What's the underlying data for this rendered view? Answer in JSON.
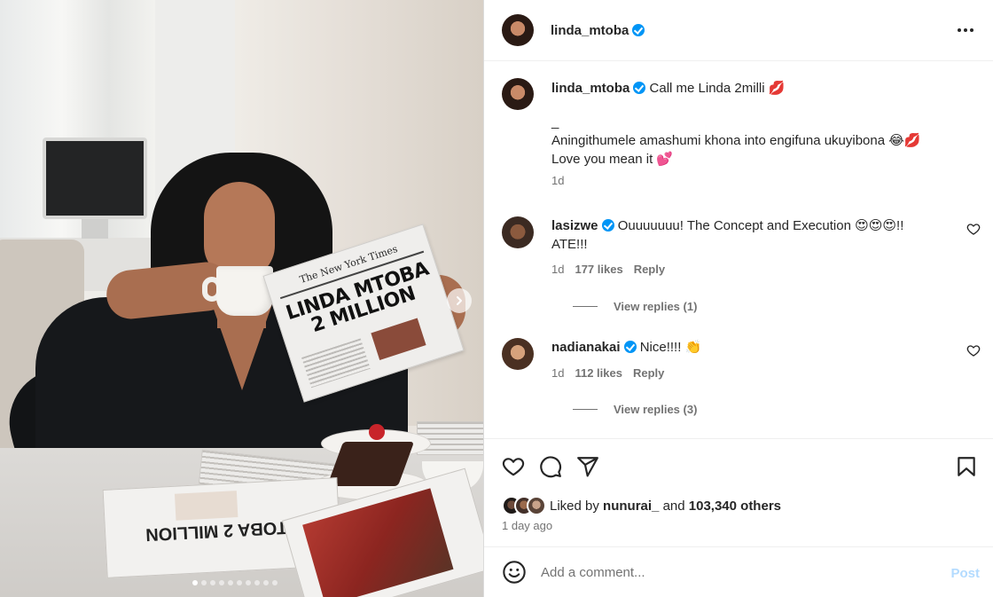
{
  "post": {
    "author": "linda_mtoba",
    "caption_line1": "Call me Linda 2milli 💋",
    "caption_separator": "_",
    "caption_line2": "Aningithumele amashumi khona into engifuna ukuyibona 😂💋",
    "caption_line3": "Love you mean it 💕",
    "caption_age": "1d",
    "newspaper": {
      "masthead": "The New York Times",
      "headline": "LINDA MTOBA 2 MILLION"
    }
  },
  "comments": [
    {
      "user": "lasizwe",
      "text": "Ouuuuuuu! The Concept and Execution 😍😍😍!! ATE!!!",
      "age": "1d",
      "likes": "177 likes",
      "reply": "Reply",
      "view_replies": "View replies (1)"
    },
    {
      "user": "nadianakai",
      "text": "Nice!!!! 👏",
      "age": "1d",
      "likes": "112 likes",
      "reply": "Reply",
      "view_replies": "View replies (3)"
    }
  ],
  "engagement": {
    "liked_by_prefix": "Liked by",
    "liked_by_user": "nunurai_",
    "liked_by_and": "and",
    "liked_by_others": "103,340 others",
    "time_ago": "1 day ago"
  },
  "compose": {
    "placeholder": "Add a comment...",
    "post_label": "Post"
  },
  "carousel": {
    "total_slides": 10,
    "active_slide": 1
  },
  "colors": {
    "verified": "#0095f6",
    "post_disabled": "#b3dbff",
    "secondary_text": "#737373"
  }
}
